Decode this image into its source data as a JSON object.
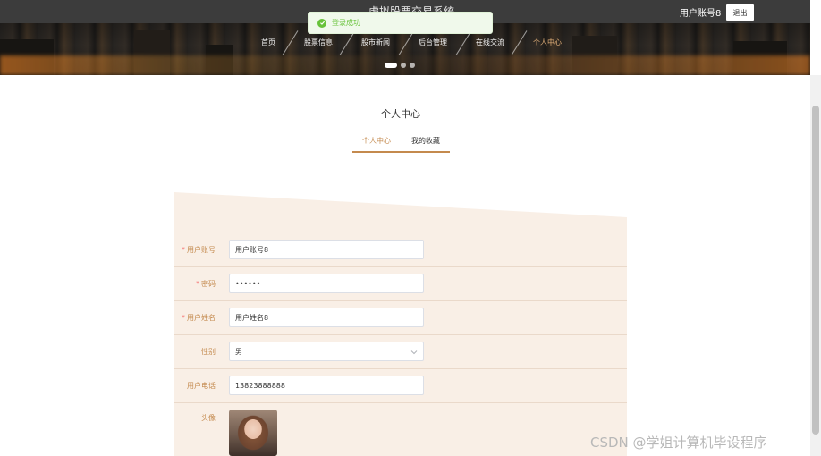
{
  "header": {
    "site_title": "虚拟股票交易系统",
    "user_name": "用户账号8",
    "logout_label": "退出",
    "nav": [
      {
        "label": "首页"
      },
      {
        "label": "股票信息"
      },
      {
        "label": "股市新闻"
      },
      {
        "label": "后台管理"
      },
      {
        "label": "在线交流"
      },
      {
        "label": "个人中心"
      }
    ],
    "active_nav": "个人中心"
  },
  "toast": {
    "message": "登录成功",
    "color": "#67c23a"
  },
  "page": {
    "title": "个人中心",
    "tabs": [
      {
        "label": "个人中心"
      },
      {
        "label": "我的收藏"
      }
    ],
    "active_tab": "个人中心"
  },
  "form": {
    "fields": [
      {
        "label": "用户账号",
        "required": true,
        "value": "用户账号8"
      },
      {
        "label": "密码",
        "required": true,
        "value": "••••••"
      },
      {
        "label": "用户姓名",
        "required": true,
        "value": "用户姓名8"
      },
      {
        "label": "性别",
        "required": false,
        "value": "男"
      },
      {
        "label": "用户电话",
        "required": false,
        "value": "13823888888"
      },
      {
        "label": "头像",
        "required": false
      }
    ]
  },
  "watermark": "CSDN @学姐计算机毕设程序",
  "colors": {
    "accent": "#c48a4e",
    "form_bg": "#f9efe6",
    "required": "#f56c6c"
  }
}
